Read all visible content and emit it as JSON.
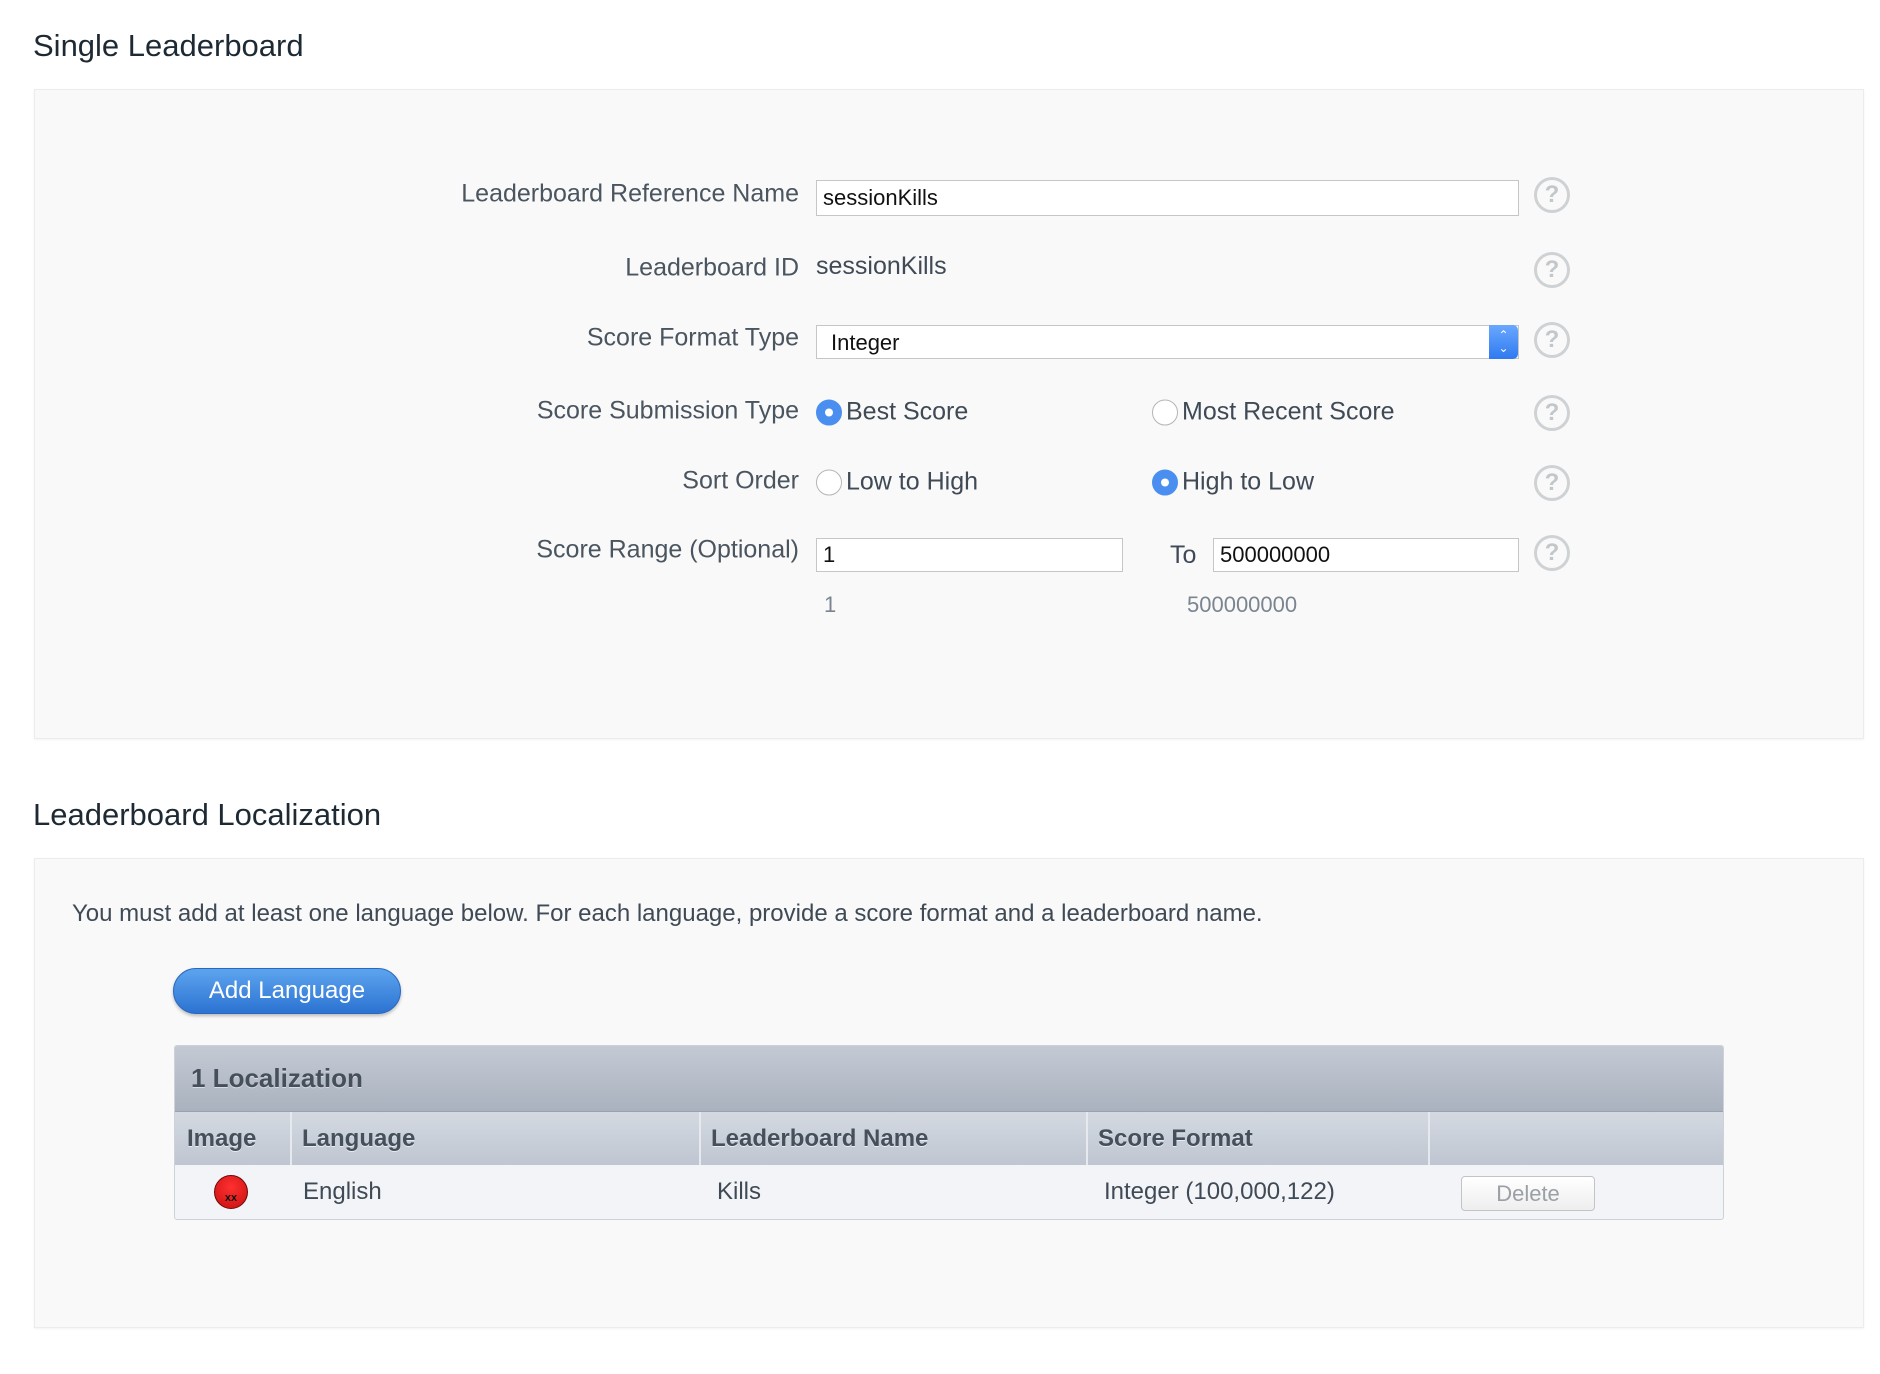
{
  "section1": {
    "title": "Single Leaderboard",
    "fields": {
      "reference_name": {
        "label": "Leaderboard Reference Name",
        "value": "sessionKills"
      },
      "leaderboard_id": {
        "label": "Leaderboard ID",
        "value": "sessionKills"
      },
      "score_format_type": {
        "label": "Score Format Type",
        "value": "Integer"
      },
      "score_submission_type": {
        "label": "Score Submission Type",
        "options": [
          "Best Score",
          "Most Recent Score"
        ],
        "selected": "Best Score"
      },
      "sort_order": {
        "label": "Sort Order",
        "options": [
          "Low to High",
          "High to Low"
        ],
        "selected": "High to Low"
      },
      "score_range": {
        "label": "Score Range (Optional)",
        "from": "1",
        "to_label": "To",
        "to": "500000000",
        "from_formatted": "1",
        "to_formatted": "500000000"
      }
    },
    "help_icon": "?"
  },
  "section2": {
    "title": "Leaderboard Localization",
    "instruction": "You must add at least one language below. For each language, provide a score format and a leaderboard name.",
    "add_language_label": "Add Language",
    "table": {
      "title": "1 Localization",
      "columns": [
        "Image",
        "Language",
        "Leaderboard Name",
        "Score Format"
      ],
      "rows": [
        {
          "image_icon": "missing-image-red-icon",
          "language": "English",
          "leaderboard_name": "Kills",
          "score_format": "Integer (100,000,122)",
          "delete_label": "Delete"
        }
      ]
    }
  },
  "colors": {
    "accent": "#4a8ff0",
    "button": "#2c73d2",
    "error_icon": "#e01a1a"
  }
}
